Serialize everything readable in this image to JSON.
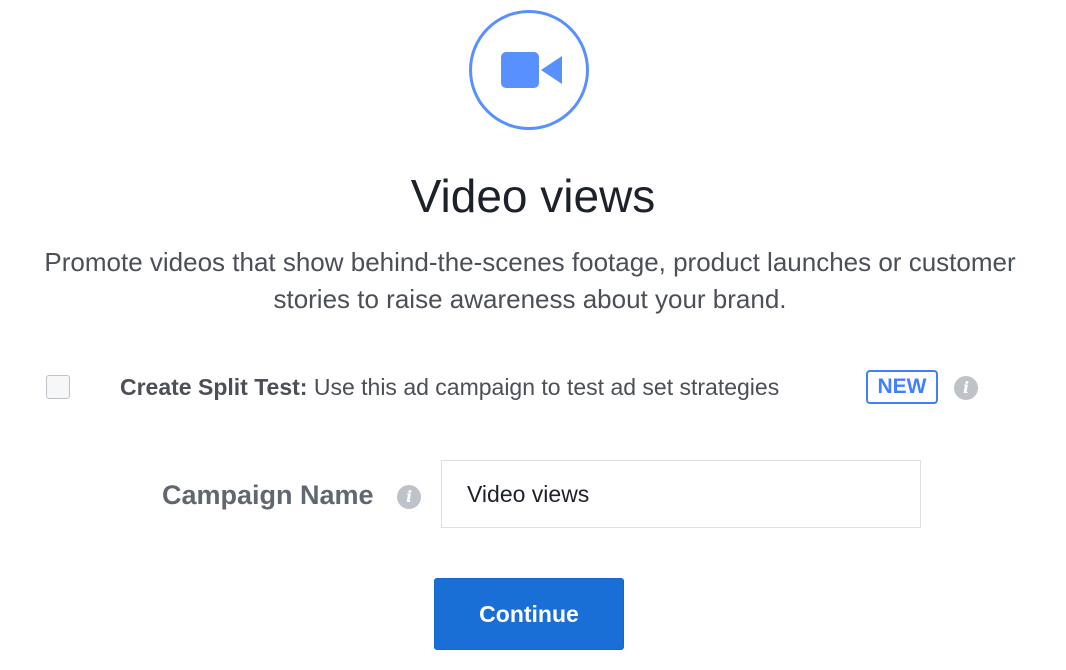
{
  "hero": {
    "icon": "video-camera-icon",
    "accent_color": "#5890ff"
  },
  "objective": {
    "title": "Video views",
    "description": "Promote videos that show behind-the-scenes footage, product launches or customer stories to raise awareness about your brand."
  },
  "split_test": {
    "checked": false,
    "label_strong": "Create Split Test:",
    "label_text": " Use this ad campaign to test ad set strategies",
    "badge": "NEW",
    "info_icon": "info-icon"
  },
  "campaign_name": {
    "label": "Campaign Name",
    "info_icon": "info-icon",
    "value": "Video views"
  },
  "actions": {
    "continue_label": "Continue",
    "button_color": "#1a6fd6"
  }
}
